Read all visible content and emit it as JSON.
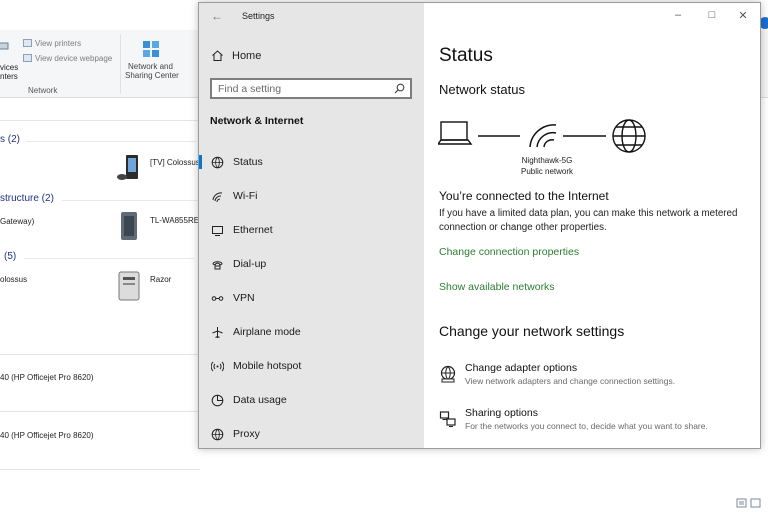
{
  "background": {
    "ribbon": {
      "view_printers": "View printers",
      "view_device_webpage": "View device webpage",
      "devices_partial_1": "vices",
      "devices_partial_2": "nters",
      "group_label": "Network",
      "network_sharing_line1": "Network and",
      "network_sharing_line2": "Sharing Center"
    },
    "groups": [
      {
        "label": "s (2)"
      },
      {
        "label": "structure (2)"
      },
      {
        "label": "(5)"
      }
    ],
    "devices": {
      "tv": "[TV] Colossus",
      "gateway_partial": "Gateway)",
      "extender": "TL-WA855RE",
      "colossus_partial": "olossus",
      "razor": "Razor",
      "printer1": "40 (HP Officejet Pro 8620)",
      "printer2": "40 (HP Officejet Pro 8620)"
    }
  },
  "settings": {
    "title": "Settings",
    "sidebar": {
      "home": "Home",
      "search_placeholder": "Find a setting",
      "section": "Network & Internet",
      "items": [
        {
          "label": "Status",
          "icon": "status-icon",
          "active": true
        },
        {
          "label": "Wi-Fi",
          "icon": "wifi-icon",
          "active": false
        },
        {
          "label": "Ethernet",
          "icon": "ethernet-icon",
          "active": false
        },
        {
          "label": "Dial-up",
          "icon": "dialup-icon",
          "active": false
        },
        {
          "label": "VPN",
          "icon": "vpn-icon",
          "active": false
        },
        {
          "label": "Airplane mode",
          "icon": "airplane-icon",
          "active": false
        },
        {
          "label": "Mobile hotspot",
          "icon": "hotspot-icon",
          "active": false
        },
        {
          "label": "Data usage",
          "icon": "data-usage-icon",
          "active": false
        },
        {
          "label": "Proxy",
          "icon": "proxy-icon",
          "active": false
        }
      ]
    },
    "content": {
      "heading": "Status",
      "network_status": "Network status",
      "network_name": "Nighthawk-5G",
      "network_type": "Public network",
      "connected": "You’re connected to the Internet",
      "limited_plan": "If you have a limited data plan, you can make this network a metered connection or change other properties.",
      "change_connection_properties": "Change connection properties",
      "show_available_networks": "Show available networks",
      "change_settings": "Change your network settings",
      "options": [
        {
          "title": "Change adapter options",
          "desc": "View network adapters and change connection settings.",
          "icon": "adapter-icon"
        },
        {
          "title": "Sharing options",
          "desc": "For the networks you connect to, decide what you want to share.",
          "icon": "sharing-icon"
        }
      ]
    },
    "accent_color": "#0078d7",
    "link_color": "#2e7d32"
  }
}
